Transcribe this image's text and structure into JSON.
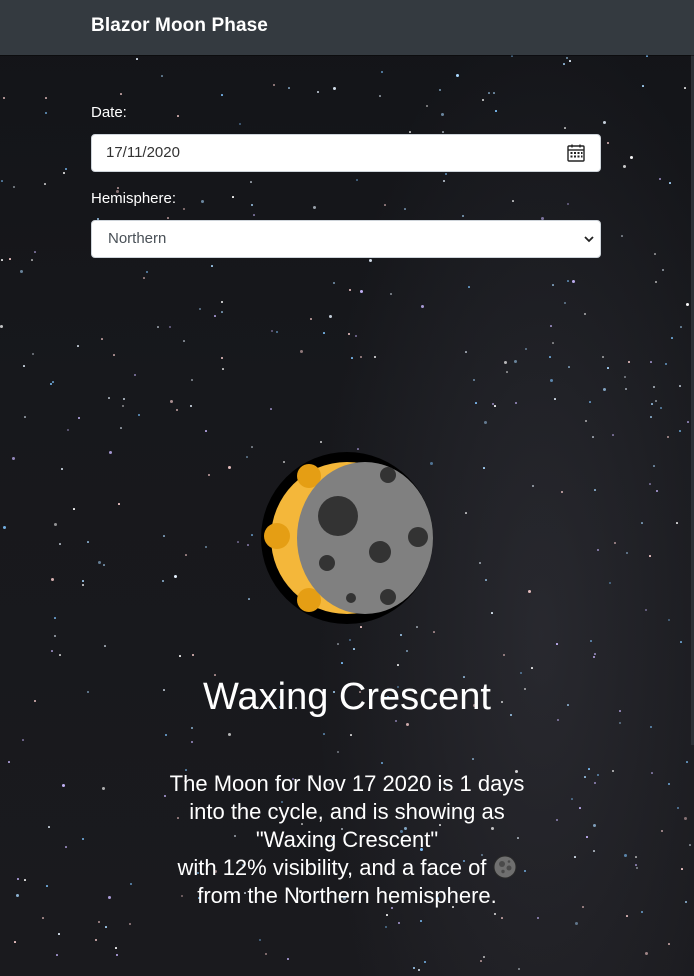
{
  "app": {
    "title": "Blazor Moon Phase"
  },
  "form": {
    "date_label": "Date:",
    "date_value": "17/11/2020",
    "hemisphere_label": "Hemisphere:",
    "hemisphere_selected": "Northern"
  },
  "moon": {
    "phase_name": "Waxing Crescent",
    "visibility_percent": 12,
    "description_line1": "The Moon for Nov 17 2020 is 1 days",
    "description_line2": "into the cycle, and is showing as",
    "description_line3": "\"Waxing Crescent\"",
    "description_line4": "with 12% visibility, and a face of",
    "description_line5": "from the Northern hemisphere."
  },
  "icons": {
    "calendar": "calendar-icon",
    "dropdown": "chevron-down-icon",
    "moon": "moon-phase-icon",
    "face": "moon-face-icon"
  },
  "colors": {
    "navbar": "#343a40",
    "moon_crescent": "#f4b73a",
    "moon_dark": "#808080",
    "moon_outline": "#000000"
  }
}
